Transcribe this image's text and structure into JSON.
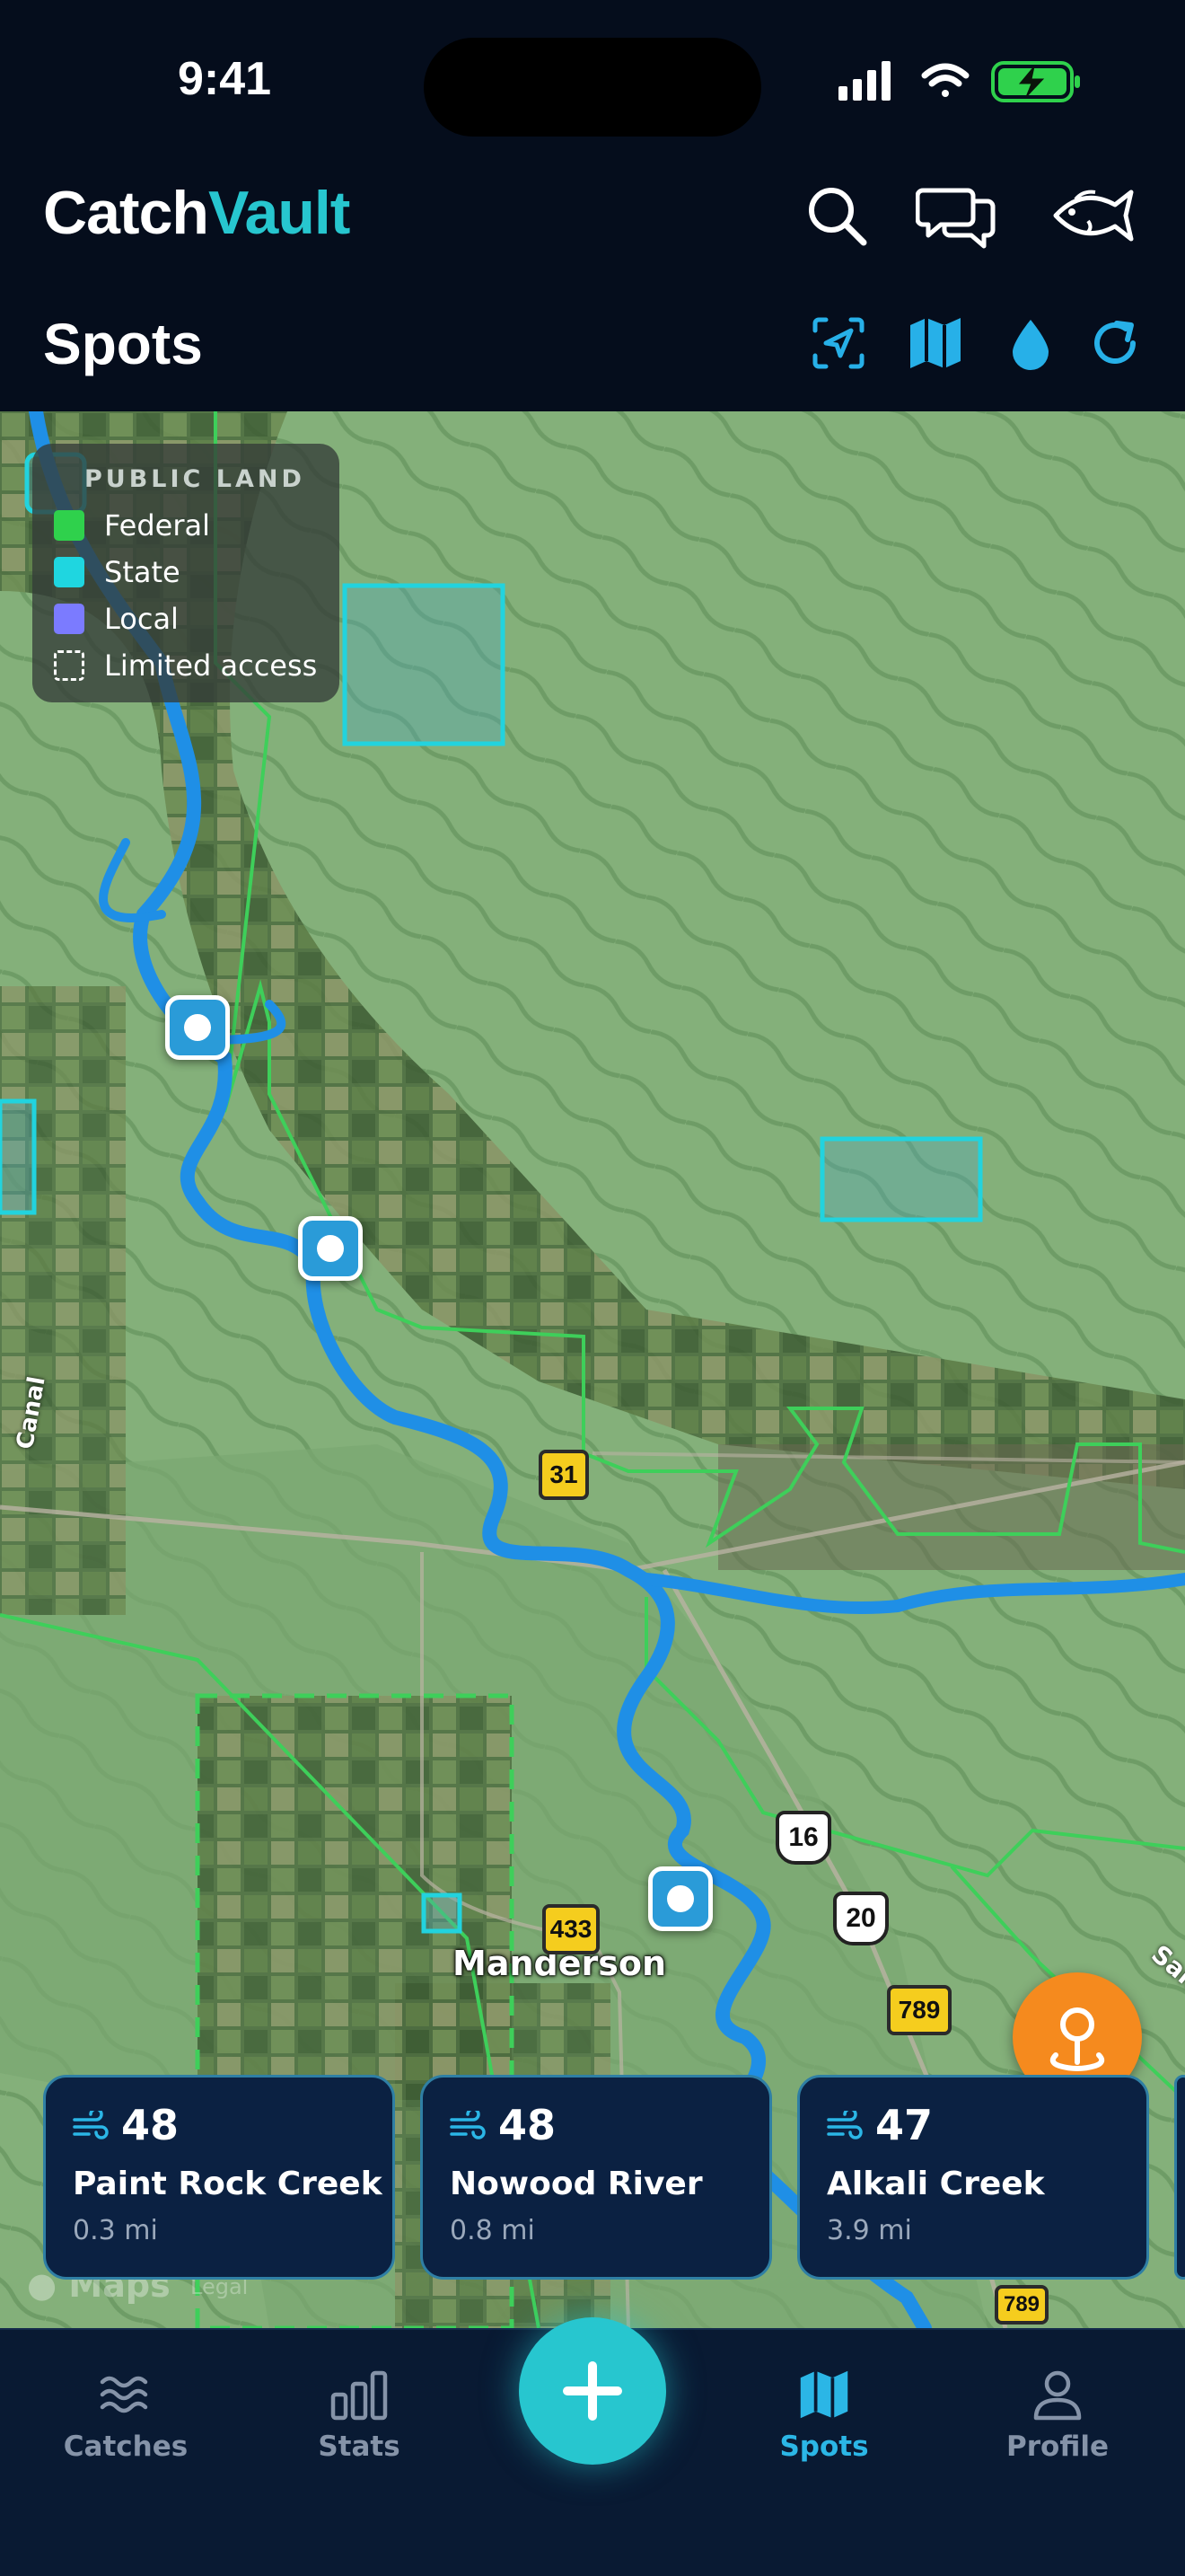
{
  "status_bar": {
    "time": "9:41"
  },
  "header": {
    "brand_part1": "Catch",
    "brand_part2": "Vault",
    "section_title": "Spots"
  },
  "header_icons": [
    "search-icon",
    "chat-icon",
    "fish-icon"
  ],
  "toolbar_icons": [
    "locate-scan-icon",
    "map-layers-icon",
    "water-drop-icon",
    "refresh-icon"
  ],
  "legend": {
    "title": "PUBLIC LAND",
    "items": [
      {
        "label": "Federal",
        "color": "#2fd14c"
      },
      {
        "label": "State",
        "color": "#1fd6e0"
      },
      {
        "label": "Local",
        "color": "#7b7bff"
      },
      {
        "label": "Limited access",
        "color": "dashed"
      }
    ]
  },
  "map": {
    "town": "Manderson",
    "shields": [
      "31",
      "433",
      "16",
      "20",
      "789",
      "789"
    ],
    "edge_labels": [
      "Canal",
      "San"
    ],
    "attribution": "Maps",
    "legal": "Legal"
  },
  "spots": [
    {
      "score": "48",
      "name": "Paint Rock Creek",
      "distance": "0.3 mi"
    },
    {
      "score": "48",
      "name": "Nowood River",
      "distance": "0.8 mi"
    },
    {
      "score": "47",
      "name": "Alkali Creek",
      "distance": "3.9 mi"
    }
  ],
  "tabs": [
    {
      "label": "Catches",
      "icon": "waves-icon",
      "active": false
    },
    {
      "label": "Stats",
      "icon": "bar-chart-icon",
      "active": false
    },
    {
      "label": "Spots",
      "icon": "map-icon",
      "active": true
    },
    {
      "label": "Profile",
      "icon": "person-icon",
      "active": false
    }
  ],
  "colors": {
    "accent": "#27c6cf",
    "active_tab": "#2bb6e6",
    "river": "#1f8fe6",
    "locate_fab": "#f58a1e"
  }
}
